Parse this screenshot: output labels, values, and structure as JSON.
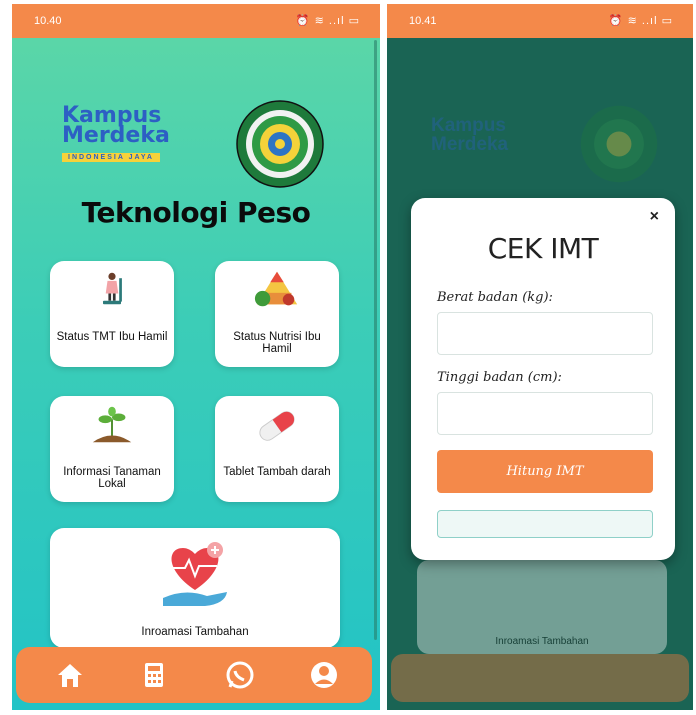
{
  "left_screen": {
    "status_time": "10.40",
    "status_icons": "⏰ ≋ ..ıl ▭",
    "logo_kampus": "Kampus",
    "logo_merdeka": "Merdeka",
    "logo_band": "INDONESIA JAYA",
    "app_title": "Teknologi Peso",
    "cards": [
      {
        "label": "Status TMT Ibu Hamil"
      },
      {
        "label": "Status Nutrisi Ibu Hamil"
      },
      {
        "label": "Informasi Tanaman Lokal"
      },
      {
        "label": "Tablet Tambah darah"
      },
      {
        "label": "Inroamasi Tambahan"
      }
    ],
    "nav": [
      "home-icon",
      "calculator-icon",
      "whatsapp-icon",
      "profile-icon"
    ]
  },
  "right_screen": {
    "status_time": "10.41",
    "status_icons": "⏰ ≋ ..ıl ▭",
    "modal": {
      "close": "×",
      "title": "CEK IMT",
      "weight_label": "Berat badan (kg):",
      "weight_value": "",
      "height_label": "Tinggi badan (cm):",
      "height_value": "",
      "button": "Hitung IMT",
      "result": ""
    },
    "background_card_label": "Inroamasi Tambahan"
  },
  "colors": {
    "accent": "#f4894a",
    "gradient_top": "#5ed7a6",
    "gradient_bottom": "#22c3c6",
    "overlay": "#1a6454"
  }
}
